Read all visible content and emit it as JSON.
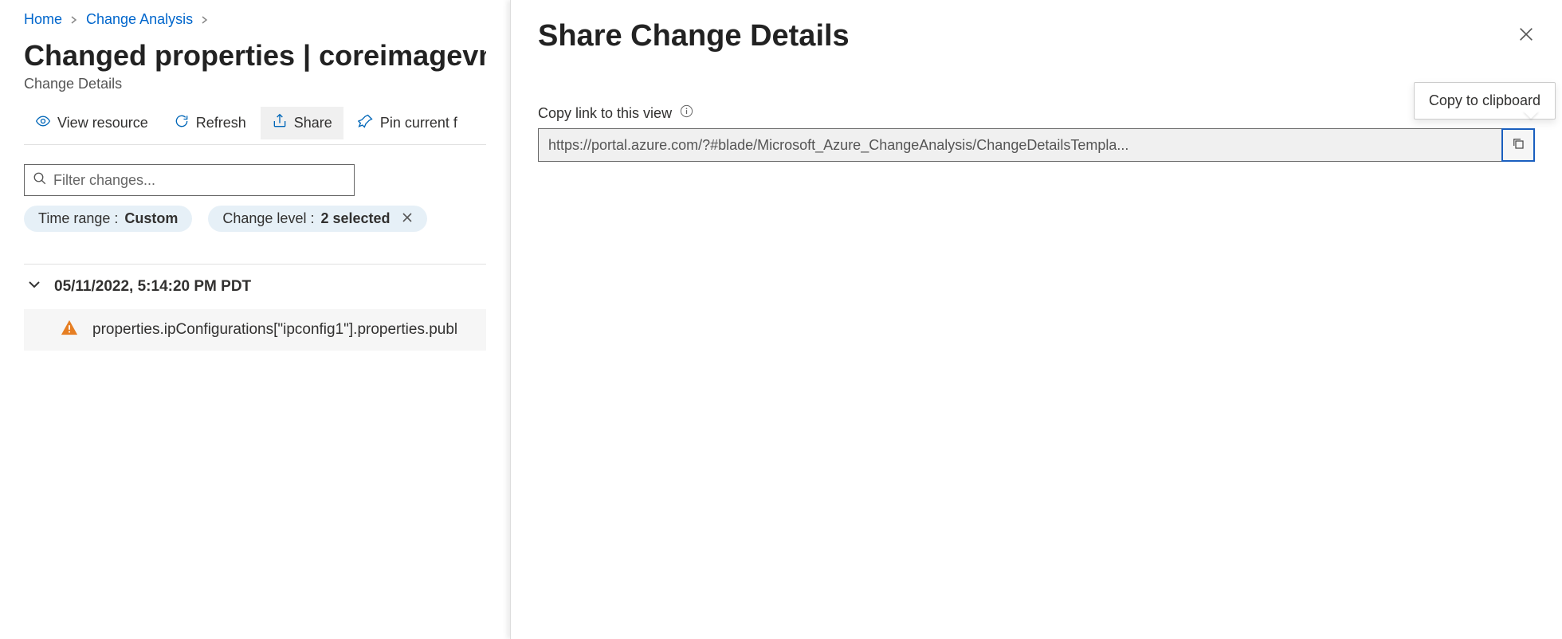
{
  "breadcrumb": {
    "items": [
      "Home",
      "Change Analysis"
    ]
  },
  "page": {
    "title": "Changed properties | coreimagevm",
    "subtitle": "Change Details"
  },
  "toolbar": {
    "view_resource": "View resource",
    "refresh": "Refresh",
    "share": "Share",
    "pin": "Pin current f"
  },
  "filter": {
    "placeholder": "Filter changes..."
  },
  "pills": {
    "time_range_label": "Time range : ",
    "time_range_value": "Custom",
    "change_level_label": "Change level : ",
    "change_level_value": "2 selected"
  },
  "changes": {
    "group_timestamp": "05/11/2022, 5:14:20 PM PDT",
    "row1": "properties.ipConfigurations[\"ipconfig1\"].properties.publ"
  },
  "panel": {
    "title": "Share Change Details",
    "field_label": "Copy link to this view",
    "url": "https://portal.azure.com/?#blade/Microsoft_Azure_ChangeAnalysis/ChangeDetailsTempla...",
    "tooltip": "Copy to clipboard"
  }
}
